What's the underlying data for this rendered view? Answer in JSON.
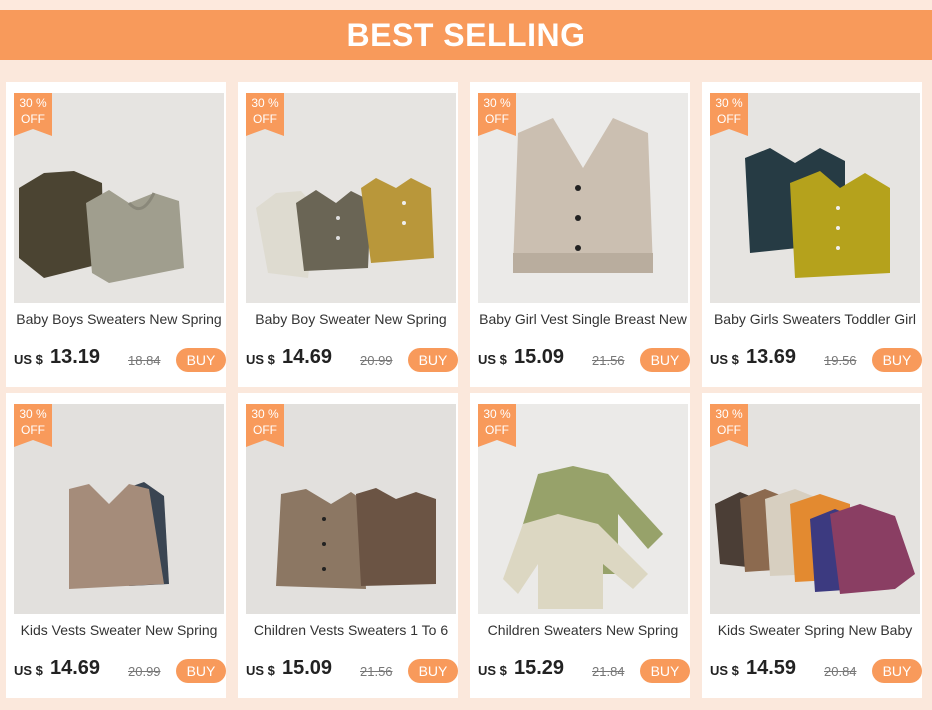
{
  "banner": {
    "title": "BEST SELLING"
  },
  "colors": {
    "accent": "#f89a5b",
    "background": "#fbe8dc"
  },
  "discount_label": {
    "line1": "30 %",
    "line2": "OFF"
  },
  "currency": "US $",
  "buy_label": "BUY",
  "products": [
    {
      "title": "Baby Boys Sweaters New Spring",
      "price": "13.19",
      "old_price": "18.84"
    },
    {
      "title": "Baby Boy Sweater New Spring",
      "price": "14.69",
      "old_price": "20.99"
    },
    {
      "title": "Baby Girl Vest Single Breast New",
      "price": "15.09",
      "old_price": "21.56"
    },
    {
      "title": "Baby Girls Sweaters Toddler Girl",
      "price": "13.69",
      "old_price": "19.56"
    },
    {
      "title": "Kids Vests Sweater New Spring",
      "price": "14.69",
      "old_price": "20.99"
    },
    {
      "title": "Children Vests Sweaters 1 To 6",
      "price": "15.09",
      "old_price": "21.56"
    },
    {
      "title": "Children Sweaters New Spring",
      "price": "15.29",
      "old_price": "21.84"
    },
    {
      "title": "Kids Sweater Spring New Baby",
      "price": "14.59",
      "old_price": "20.84"
    }
  ]
}
